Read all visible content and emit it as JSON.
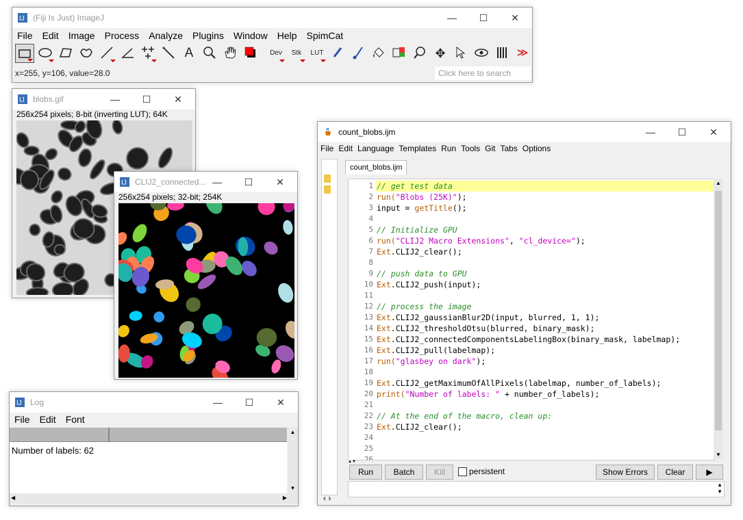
{
  "imagej": {
    "title": "(Fiji Is Just) ImageJ",
    "menu": [
      "File",
      "Edit",
      "Image",
      "Process",
      "Analyze",
      "Plugins",
      "Window",
      "Help",
      "SpimCat"
    ],
    "tools": {
      "dev": "Dev",
      "stk": "Stk",
      "lut": "LUT"
    },
    "status": "x=255, y=106, value=28.0",
    "search_placeholder": "Click here to search"
  },
  "blobs": {
    "title": "blobs.gif",
    "info": "256x254 pixels; 8-bit (inverting LUT); 64K"
  },
  "clij": {
    "title": "CLIJ2_connected...",
    "info": "256x254 pixels; 32-bit; 254K"
  },
  "log": {
    "title": "Log",
    "menu": [
      "File",
      "Edit",
      "Font"
    ],
    "text": "Number of labels: 62"
  },
  "editor": {
    "title": "count_blobs.ijm",
    "menu": [
      "File",
      "Edit",
      "Language",
      "Templates",
      "Run",
      "Tools",
      "Git",
      "Tabs",
      "Options"
    ],
    "tab": "count_blobs.ijm",
    "buttons": {
      "run": "Run",
      "batch": "Batch",
      "kill": "Kill",
      "persistent": "persistent",
      "show_errors": "Show Errors",
      "clear": "Clear"
    },
    "lines": [
      [
        {
          "t": "// get test data",
          "c": "cm"
        }
      ],
      [
        {
          "t": "run(",
          "c": "fn"
        },
        {
          "t": "\"Blobs (25K)\"",
          "c": "st"
        },
        {
          "t": ");",
          "c": ""
        }
      ],
      [
        {
          "t": "input = ",
          "c": ""
        },
        {
          "t": "getTitle",
          "c": "fn"
        },
        {
          "t": "();",
          "c": ""
        }
      ],
      [],
      [
        {
          "t": "// Initialize GPU",
          "c": "cm"
        }
      ],
      [
        {
          "t": "run(",
          "c": "fn"
        },
        {
          "t": "\"CLIJ2 Macro Extensions\"",
          "c": "st"
        },
        {
          "t": ", ",
          "c": ""
        },
        {
          "t": "\"cl_device=\"",
          "c": "st"
        },
        {
          "t": ");",
          "c": ""
        }
      ],
      [
        {
          "t": "Ext",
          "c": "fn"
        },
        {
          "t": ".CLIJ2_clear();",
          "c": ""
        }
      ],
      [],
      [
        {
          "t": "// push data to GPU",
          "c": "cm"
        }
      ],
      [
        {
          "t": "Ext",
          "c": "fn"
        },
        {
          "t": ".CLIJ2_push(input);",
          "c": ""
        }
      ],
      [],
      [
        {
          "t": "// process the image",
          "c": "cm"
        }
      ],
      [
        {
          "t": "Ext",
          "c": "fn"
        },
        {
          "t": ".CLIJ2_gaussianBlur2D(input, blurred, 1, 1);",
          "c": ""
        }
      ],
      [
        {
          "t": "Ext",
          "c": "fn"
        },
        {
          "t": ".CLIJ2_thresholdOtsu(blurred, binary_mask);",
          "c": ""
        }
      ],
      [
        {
          "t": "Ext",
          "c": "fn"
        },
        {
          "t": ".CLIJ2_connectedComponentsLabelingBox(binary_mask, labelmap);",
          "c": ""
        }
      ],
      [
        {
          "t": "Ext",
          "c": "fn"
        },
        {
          "t": ".CLIJ2_pull(labelmap);",
          "c": ""
        }
      ],
      [
        {
          "t": "run(",
          "c": "fn"
        },
        {
          "t": "\"glasbey on dark\"",
          "c": "st"
        },
        {
          "t": ");",
          "c": ""
        }
      ],
      [],
      [
        {
          "t": "Ext",
          "c": "fn"
        },
        {
          "t": ".CLIJ2_getMaximumOfAllPixels(labelmap, number_of_labels);",
          "c": ""
        }
      ],
      [
        {
          "t": "print(",
          "c": "fn"
        },
        {
          "t": "\"Number of labels: \"",
          "c": "st"
        },
        {
          "t": " + number_of_labels);",
          "c": ""
        }
      ],
      [],
      [
        {
          "t": "// At the end of the macro, clean up:",
          "c": "cm"
        }
      ],
      [
        {
          "t": "Ext",
          "c": "fn"
        },
        {
          "t": ".CLIJ2_clear();",
          "c": ""
        }
      ],
      [],
      [],
      []
    ]
  },
  "colors": {
    "label_palette": [
      "#ff3da0",
      "#7fd63a",
      "#2f9cf0",
      "#f2a21b",
      "#9b59b6",
      "#1abc9c",
      "#e74c3c",
      "#f1c40f",
      "#00d1ff",
      "#8e9b7a",
      "#ff7f50",
      "#c71585",
      "#3cb371",
      "#6a5acd",
      "#d2b48c",
      "#ff69b4",
      "#20b2aa",
      "#b0e0e6",
      "#0047ab",
      "#556b2f"
    ]
  }
}
